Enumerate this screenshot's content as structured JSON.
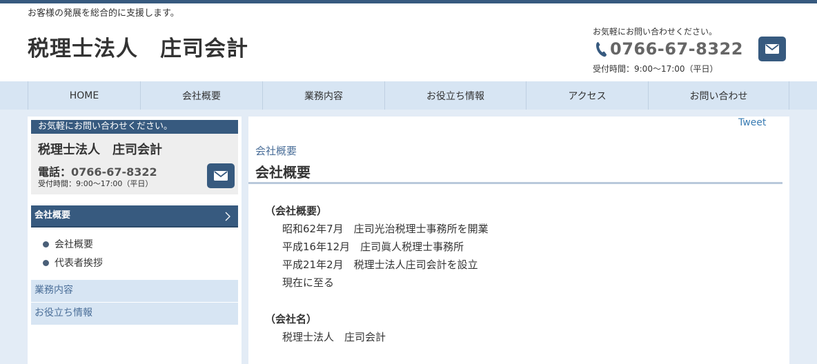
{
  "header": {
    "tagline": "お客様の発展を総合的に支援します。",
    "site_title": "税理士法人　庄司会計",
    "contact_note": "お気軽にお問い合わせください。",
    "phone": "0766-67-8322",
    "hours": "受付時間：9:00〜17:00（平日）"
  },
  "nav": {
    "items": [
      {
        "label": "HOME"
      },
      {
        "label": "会社概要"
      },
      {
        "label": "業務内容"
      },
      {
        "label": "お役立ち情報"
      },
      {
        "label": "アクセス"
      },
      {
        "label": "お問い合わせ"
      }
    ]
  },
  "sidebar": {
    "contact_head": "お気軽にお問い合わせください。",
    "name": "税理士法人　庄司会計",
    "tel_label": "電話：",
    "tel_number": "0766-67-8322",
    "hours": "受付時間：9:00〜17:00（平日）",
    "section_head": "会社概要",
    "sub_items": [
      {
        "label": "会社概要"
      },
      {
        "label": "代表者挨拶"
      }
    ],
    "links": [
      {
        "label": "業務内容"
      },
      {
        "label": "お役立ち情報"
      }
    ]
  },
  "main": {
    "tweet": "Tweet",
    "breadcrumb": "会社概要",
    "title": "会社概要",
    "sections": [
      {
        "heading": "（会社概要）",
        "lines": [
          "昭和62年7月　庄司光治税理士事務所を開業",
          "平成16年12月　庄司眞人税理士事務所",
          "平成21年2月　税理士法人庄司会計を設立",
          "現在に至る"
        ]
      },
      {
        "heading": "（会社名）",
        "lines": [
          "税理士法人　庄司会計"
        ]
      }
    ]
  },
  "colors": {
    "brand": "#375a7f",
    "nav_bg": "#d7e5f3",
    "link": "#4b6f99"
  }
}
